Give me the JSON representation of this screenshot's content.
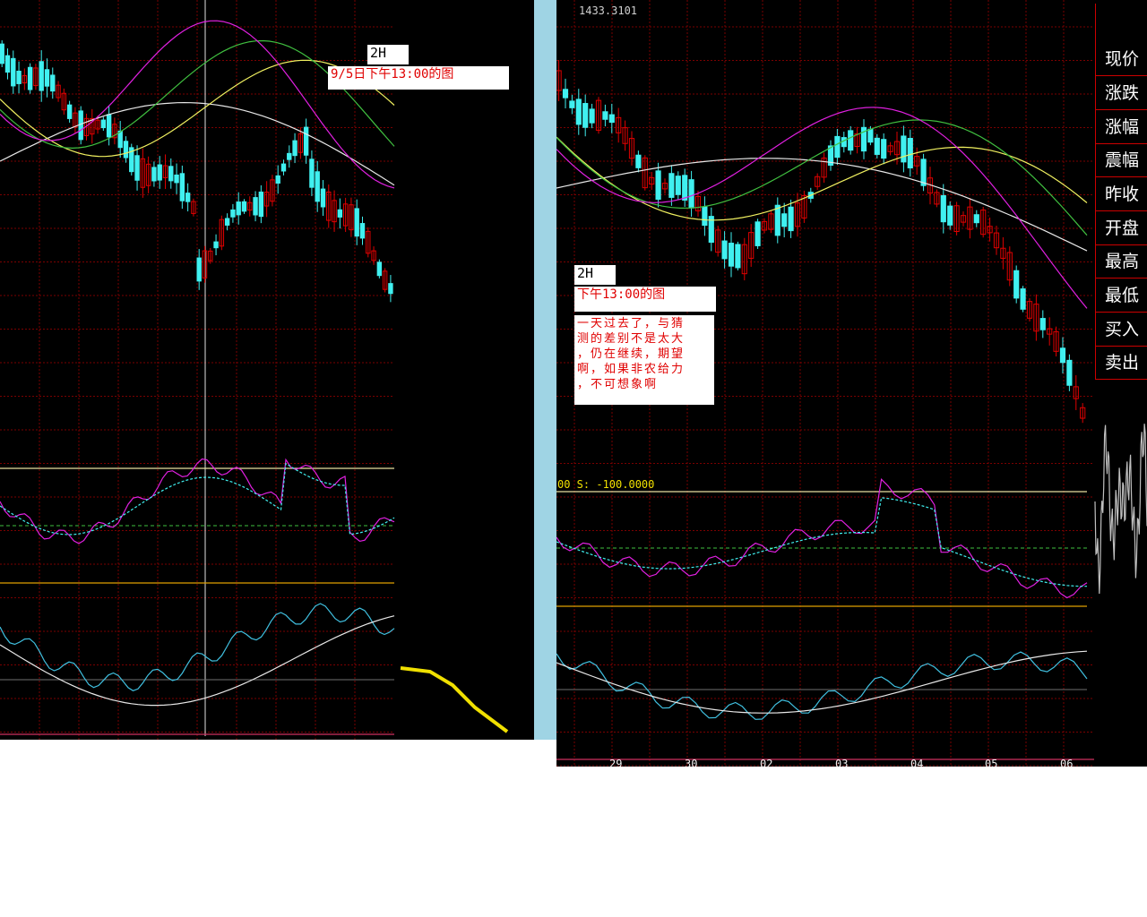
{
  "left_chart": {
    "label_period": "2H",
    "label_caption": "9/5日下午13:00的图"
  },
  "right_chart": {
    "price_label": "1433.3101",
    "label_period": "2H",
    "label_caption": "下午13:00的图",
    "comment": "一天过去了，与猜\n测的差别不是太大\n，仍在继续，期望\n啊，如果非农给力\n，不可想象啊",
    "osc_label": "00 S: -100.0000",
    "x_labels": [
      "29",
      "30",
      "02",
      "03",
      "04",
      "05",
      "06"
    ]
  },
  "quote_menu": {
    "items": [
      "现价",
      "涨跌",
      "涨幅",
      "震幅",
      "昨收",
      "开盘",
      "最高",
      "最低",
      "买入",
      "卖出"
    ]
  },
  "colors": {
    "background": "#000000",
    "grid": "#7a0000",
    "up": "#e00000",
    "down": "#40f0f0",
    "ma_white": "#e8e8e8",
    "ma_yellow": "#f0f060",
    "ma_green": "#40c040",
    "ma_magenta": "#e020e0",
    "forecast": "#f0e000"
  },
  "chart_data": [
    {
      "type": "candlestick",
      "title": "",
      "x": [],
      "series": []
    },
    {
      "type": "candlestick",
      "title": "",
      "x": [
        "29",
        "30",
        "02",
        "03",
        "04",
        "05",
        "06"
      ],
      "series": []
    }
  ]
}
